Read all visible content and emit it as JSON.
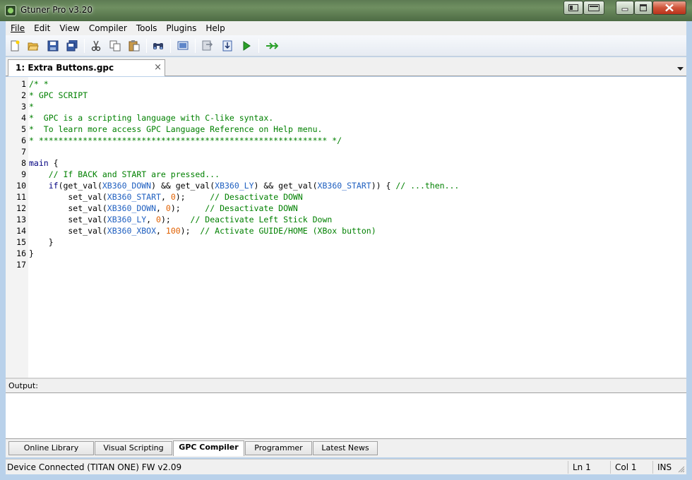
{
  "window": {
    "title": "Gtuner Pro v3.20"
  },
  "menu": [
    "File",
    "Edit",
    "View",
    "Compiler",
    "Tools",
    "Plugins",
    "Help"
  ],
  "editor_tab": {
    "label": "1: Extra Buttons.gpc",
    "close": "×"
  },
  "line_numbers": [
    "1",
    "2",
    "3",
    "4",
    "5",
    "6",
    "7",
    "8",
    "9",
    "10",
    "11",
    "12",
    "13",
    "14",
    "15",
    "16",
    "17"
  ],
  "code": {
    "l1": "/* *",
    "l2": "* GPC SCRIPT",
    "l3": "*",
    "l4": "*  GPC is a scripting language with C-like syntax.",
    "l5": "*  To learn more access GPC Language Reference on Help menu.",
    "l6": "* *********************************************************** */",
    "l8_kw": "main",
    "l8_rest": " {",
    "l9": "    // If BACK and START are pressed...",
    "l10": {
      "indent": "    ",
      "kw": "if",
      "p1": "(get_val(",
      "c1": "XB360_DOWN",
      "p2": ") && get_val(",
      "c2": "XB360_LY",
      "p3": ") && get_val(",
      "c3": "XB360_START",
      "p4": ")) { ",
      "comment": "// ...then..."
    },
    "l11": {
      "pre": "        set_val(",
      "c": "XB360_START",
      "mid": ", ",
      "n": "0",
      "post": ");     ",
      "comment": "// Desactivate DOWN"
    },
    "l12": {
      "pre": "        set_val(",
      "c": "XB360_DOWN",
      "mid": ", ",
      "n": "0",
      "post": ");     ",
      "comment": "// Desactivate DOWN"
    },
    "l13": {
      "pre": "        set_val(",
      "c": "XB360_LY",
      "mid": ", ",
      "n": "0",
      "post": ");    ",
      "comment": "// Deactivate Left Stick Down"
    },
    "l14": {
      "pre": "        set_val(",
      "c": "XB360_XBOX",
      "mid": ", ",
      "n": "100",
      "post": ");  ",
      "comment": "// Activate GUIDE/HOME (XBox button)"
    },
    "l15": "    }",
    "l16": "}"
  },
  "output": {
    "label": "Output:"
  },
  "bottom_tabs": [
    "Online Library",
    "Visual Scripting",
    "GPC Compiler",
    "Programmer",
    "Latest News"
  ],
  "status": {
    "device": "Device Connected (TITAN ONE) FW v2.09",
    "line": "Ln 1",
    "col": "Col 1",
    "mode": "INS"
  },
  "colors": {
    "comment": "#008000",
    "keyword": "#000080",
    "constant": "#2060c0",
    "number": "#e06000"
  }
}
